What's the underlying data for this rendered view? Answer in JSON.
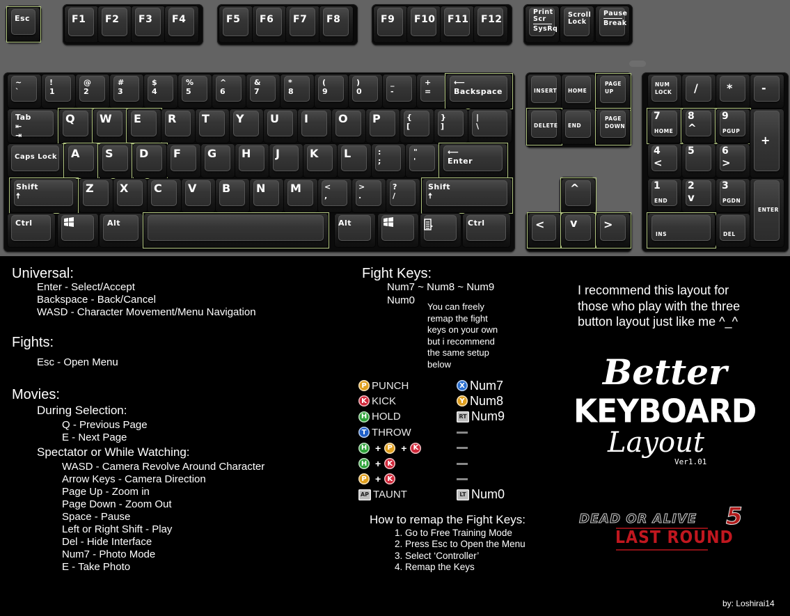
{
  "keyboard": {
    "highlight_color": "#b3c781",
    "function_row": [
      {
        "id": "esc",
        "label": "Esc",
        "highlight": true
      },
      {
        "id": "f1",
        "label": "F1"
      },
      {
        "id": "f2",
        "label": "F2"
      },
      {
        "id": "f3",
        "label": "F3"
      },
      {
        "id": "f4",
        "label": "F4"
      },
      {
        "id": "f5",
        "label": "F5"
      },
      {
        "id": "f6",
        "label": "F6"
      },
      {
        "id": "f7",
        "label": "F7"
      },
      {
        "id": "f8",
        "label": "F8"
      },
      {
        "id": "f9",
        "label": "F9"
      },
      {
        "id": "f10",
        "label": "F10"
      },
      {
        "id": "f11",
        "label": "F11"
      },
      {
        "id": "f12",
        "label": "F12"
      },
      {
        "id": "printscr",
        "label": "Print\nScr",
        "sub": "SysRq"
      },
      {
        "id": "scrolllock",
        "label": "Scroll\nLock"
      },
      {
        "id": "pause",
        "label": "Pause",
        "sub": "Break"
      }
    ],
    "number_row": [
      {
        "id": "backtick",
        "label": "~\n`"
      },
      {
        "id": "1",
        "label": "!\n1"
      },
      {
        "id": "2",
        "label": "@\n2"
      },
      {
        "id": "3",
        "label": "#\n3"
      },
      {
        "id": "4",
        "label": "$\n4"
      },
      {
        "id": "5",
        "label": "%\n5"
      },
      {
        "id": "6",
        "label": "^\n6"
      },
      {
        "id": "7",
        "label": "&\n7"
      },
      {
        "id": "8",
        "label": "*\n8"
      },
      {
        "id": "9",
        "label": "(\n9"
      },
      {
        "id": "0",
        "label": ")\n0"
      },
      {
        "id": "minus",
        "label": "_\n-"
      },
      {
        "id": "equals",
        "label": "+\n="
      },
      {
        "id": "backspace",
        "label": "⟵\nBackspace",
        "highlight": true
      }
    ],
    "tab_row": [
      {
        "id": "tab",
        "label": "Tab\n⇤\n⇥"
      },
      {
        "id": "q",
        "label": "Q",
        "highlight": true
      },
      {
        "id": "w",
        "label": "W",
        "highlight": true
      },
      {
        "id": "e",
        "label": "E",
        "highlight": true
      },
      {
        "id": "r",
        "label": "R"
      },
      {
        "id": "t",
        "label": "T"
      },
      {
        "id": "y",
        "label": "Y"
      },
      {
        "id": "u",
        "label": "U"
      },
      {
        "id": "i",
        "label": "I"
      },
      {
        "id": "o",
        "label": "O"
      },
      {
        "id": "p",
        "label": "P"
      },
      {
        "id": "lbracket",
        "label": "{\n["
      },
      {
        "id": "rbracket",
        "label": "}\n]"
      },
      {
        "id": "backslash",
        "label": "|\n\\"
      }
    ],
    "caps_row": [
      {
        "id": "capslock",
        "label": "Caps Lock"
      },
      {
        "id": "a",
        "label": "A",
        "highlight": true
      },
      {
        "id": "s",
        "label": "S",
        "highlight": true
      },
      {
        "id": "d",
        "label": "D",
        "highlight": true
      },
      {
        "id": "f",
        "label": "F"
      },
      {
        "id": "g",
        "label": "G"
      },
      {
        "id": "h",
        "label": "H"
      },
      {
        "id": "j",
        "label": "J"
      },
      {
        "id": "k",
        "label": "K"
      },
      {
        "id": "l",
        "label": "L"
      },
      {
        "id": "semicolon",
        "label": ":\n;"
      },
      {
        "id": "quote",
        "label": "\"\n'"
      },
      {
        "id": "enter",
        "label": "⟵\nEnter",
        "highlight": true
      }
    ],
    "shift_row": [
      {
        "id": "lshift",
        "label": "Shift\n🠅",
        "highlight": true
      },
      {
        "id": "z",
        "label": "Z"
      },
      {
        "id": "x",
        "label": "X"
      },
      {
        "id": "c",
        "label": "C"
      },
      {
        "id": "v",
        "label": "V"
      },
      {
        "id": "b",
        "label": "B"
      },
      {
        "id": "n",
        "label": "N"
      },
      {
        "id": "m",
        "label": "M"
      },
      {
        "id": "comma",
        "label": "<\n,"
      },
      {
        "id": "period",
        "label": ">\n."
      },
      {
        "id": "slash",
        "label": "?\n/"
      },
      {
        "id": "rshift",
        "label": "Shift\n🠅",
        "highlight": true
      }
    ],
    "bottom_row": [
      {
        "id": "lctrl",
        "label": "Ctrl"
      },
      {
        "id": "lwin",
        "label": "windows-icon"
      },
      {
        "id": "lalt",
        "label": "Alt"
      },
      {
        "id": "space",
        "label": "",
        "highlight": true
      },
      {
        "id": "ralt",
        "label": "Alt"
      },
      {
        "id": "rwin",
        "label": "windows-icon"
      },
      {
        "id": "menu",
        "label": "menu-icon"
      },
      {
        "id": "rctrl",
        "label": "Ctrl"
      }
    ],
    "nav_cluster": [
      {
        "id": "insert",
        "label": "INSERT"
      },
      {
        "id": "home",
        "label": "HOME"
      },
      {
        "id": "pageup",
        "label": "PAGE\nUP",
        "highlight": true
      },
      {
        "id": "delete",
        "label": "DELETE",
        "highlight": true
      },
      {
        "id": "end",
        "label": "END"
      },
      {
        "id": "pagedown",
        "label": "PAGE\nDOWN",
        "highlight": true
      }
    ],
    "arrows": [
      {
        "id": "up",
        "label": "^",
        "highlight": true
      },
      {
        "id": "left",
        "label": "<",
        "highlight": true
      },
      {
        "id": "down",
        "label": "v",
        "highlight": true
      },
      {
        "id": "right",
        "label": ">",
        "highlight": true
      }
    ],
    "numpad": [
      {
        "id": "numlock",
        "label": "NUM\nLOCK"
      },
      {
        "id": "np_div",
        "label": "/"
      },
      {
        "id": "np_mul",
        "label": "*"
      },
      {
        "id": "np_sub",
        "label": "-"
      },
      {
        "id": "np7",
        "label": "7",
        "sub": "HOME",
        "highlight": true
      },
      {
        "id": "np8",
        "label": "8",
        "sub": "^",
        "highlight": true
      },
      {
        "id": "np9",
        "label": "9",
        "sub": "PGUP",
        "highlight": true
      },
      {
        "id": "np_add",
        "label": "+"
      },
      {
        "id": "np4",
        "label": "4",
        "sub": "<"
      },
      {
        "id": "np5",
        "label": "5"
      },
      {
        "id": "np6",
        "label": "6",
        "sub": ">"
      },
      {
        "id": "np1",
        "label": "1",
        "sub": "END"
      },
      {
        "id": "np2",
        "label": "2",
        "sub": "v"
      },
      {
        "id": "np3",
        "label": "3",
        "sub": "PGDN"
      },
      {
        "id": "np_enter",
        "label": "ENTER"
      },
      {
        "id": "np0",
        "label": "INS",
        "highlight": true
      },
      {
        "id": "np_dot",
        "label": "DEL"
      }
    ]
  },
  "universal": {
    "heading": "Universal:",
    "items": [
      "Enter - Select/Accept",
      "Backspace - Back/Cancel",
      "WASD - Character Movement/Menu Navigation"
    ]
  },
  "fights": {
    "heading": "Fights:",
    "items": [
      "Esc - Open Menu"
    ]
  },
  "movies": {
    "heading": "Movies:",
    "selection_heading": "During Selection:",
    "selection_items": [
      "Q - Previous Page",
      "E - Next Page"
    ],
    "spectator_heading": "Spectator or While Watching:",
    "spectator_items": [
      "WASD - Camera Revolve Around Character",
      "Arrow Keys - Camera Direction",
      "Page Up - Zoom in",
      "Page Down - Zoom Out",
      "Space - Pause",
      "Left or Right Shift - Play",
      "Del - Hide Interface",
      "Num7 - Photo Mode",
      "E - Take Photo"
    ]
  },
  "fight_keys": {
    "heading": "Fight Keys:",
    "line1": "Num7 ~ Num8 ~ Num9",
    "line2": "Num0",
    "note": [
      "You can freely",
      "remap the fight",
      "keys on your own",
      "but i recommend",
      "the same setup",
      "below"
    ],
    "mappings": [
      {
        "buttons": [
          {
            "glyph": "P",
            "color": "#e0a020"
          }
        ],
        "action": "PUNCH",
        "pad": {
          "glyph": "X",
          "color": "#2a6fd0",
          "shape": "circle"
        },
        "key": "Num7"
      },
      {
        "buttons": [
          {
            "glyph": "K",
            "color": "#d0283a"
          }
        ],
        "action": "KICK",
        "pad": {
          "glyph": "Y",
          "color": "#e0a020",
          "shape": "circle"
        },
        "key": "Num8"
      },
      {
        "buttons": [
          {
            "glyph": "H",
            "color": "#2fa23a"
          }
        ],
        "action": "HOLD",
        "pad": {
          "glyph": "RT",
          "color": "#bbbbbb",
          "shape": "square"
        },
        "key": "Num9"
      },
      {
        "buttons": [
          {
            "glyph": "T",
            "color": "#1f5fc8"
          }
        ],
        "action": "THROW",
        "pad": null,
        "key": ""
      },
      {
        "buttons": [
          {
            "glyph": "H",
            "color": "#2fa23a"
          },
          {
            "glyph": "P",
            "color": "#e0a020"
          },
          {
            "glyph": "K",
            "color": "#d0283a"
          }
        ],
        "action": "",
        "pad": null,
        "key": ""
      },
      {
        "buttons": [
          {
            "glyph": "H",
            "color": "#2fa23a"
          },
          {
            "glyph": "K",
            "color": "#d0283a"
          }
        ],
        "action": "",
        "pad": null,
        "key": ""
      },
      {
        "buttons": [
          {
            "glyph": "P",
            "color": "#e0a020"
          },
          {
            "glyph": "K",
            "color": "#d0283a"
          }
        ],
        "action": "",
        "pad": null,
        "key": ""
      },
      {
        "buttons": [
          {
            "glyph": "AP",
            "color": "#bbbbbb",
            "shape": "square"
          }
        ],
        "action": "TAUNT",
        "pad": {
          "glyph": "LT",
          "color": "#bbbbbb",
          "shape": "square"
        },
        "key": "Num0"
      }
    ]
  },
  "remap": {
    "heading": "How to remap the Fight Keys:",
    "steps": [
      "1. Go to Free Training Mode",
      "2. Press Esc to Open the Menu",
      "3. Select ‘Controller’",
      "4. Remap the Keys"
    ]
  },
  "recommend": [
    "I recommend this layout for",
    "those who play with the three",
    "button layout just like me ^_^"
  ],
  "title": {
    "line1": "Better",
    "line2": "KEYBOARD",
    "line3": "Layout",
    "version": "Ver1.01"
  },
  "logo": {
    "line1": "DEAD OR ALIVE",
    "number": "5",
    "line2": "LAST ROUND"
  },
  "credit": "by: Loshirai14"
}
